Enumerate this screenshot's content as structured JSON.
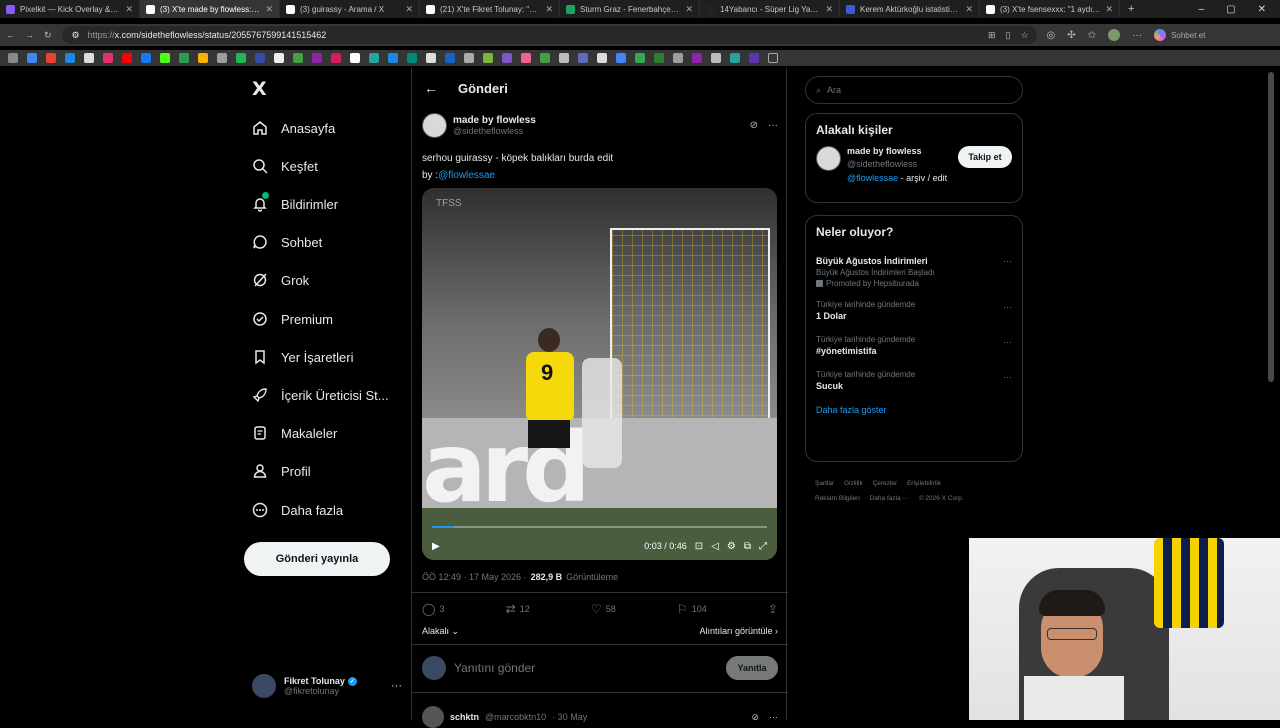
{
  "browser": {
    "tabs": [
      {
        "title": "Pixelkit — Kick Overlay & Bot",
        "color": "#8a5cf6"
      },
      {
        "title": "(3) X'te made by flowless: \"serh",
        "color": "#ffffff",
        "active": true
      },
      {
        "title": "(3) guirassy - Arama / X",
        "color": "#ffffff"
      },
      {
        "title": "(21) X'te Fikret Tolunay: \"@keys",
        "color": "#ffffff"
      },
      {
        "title": "Sturm Graz - Fenerbahçe canlı",
        "color": "#1ea362"
      },
      {
        "title": "14Yabancı - Süper Lig Yabancı",
        "color": "#222222"
      },
      {
        "title": "Kerem Aktürkoğlu istatistikleri",
        "color": "#3b5bdb"
      },
      {
        "title": "(3) X'te fsensexxx: \"1 aydır Fen",
        "color": "#ffffff"
      }
    ],
    "url_prefix": "https://",
    "url": "x.com/sidetheflowless/status/2055767599141515462",
    "chat_label": "Sohbet et",
    "window_controls": [
      "–",
      "▢",
      "✕"
    ]
  },
  "nav": {
    "logo": "X",
    "items": [
      {
        "label": "Anasayfa",
        "icon": "home-icon"
      },
      {
        "label": "Keşfet",
        "icon": "search-icon"
      },
      {
        "label": "Bildirimler",
        "icon": "bell-icon"
      },
      {
        "label": "Sohbet",
        "icon": "chat-icon"
      },
      {
        "label": "Grok",
        "icon": "grok-icon"
      },
      {
        "label": "Premium",
        "icon": "premium-icon"
      },
      {
        "label": "Yer İşaretleri",
        "icon": "bookmark-icon"
      },
      {
        "label": "İçerik Üreticisi St...",
        "icon": "rocket-icon"
      },
      {
        "label": "Makaleler",
        "icon": "article-icon"
      },
      {
        "label": "Profil",
        "icon": "person-icon"
      },
      {
        "label": "Daha fazla",
        "icon": "more-circle-icon"
      }
    ],
    "post_button": "Gönderi yayınla",
    "account": {
      "name": "Fikret Tolunay",
      "handle": "@fikretolunay"
    }
  },
  "main": {
    "header_title": "Gönderi",
    "post": {
      "author_name": "made by flowless",
      "author_handle": "@sidetheflowless",
      "text_line1": "serhou guirassy - köpek balıkları burda edit",
      "text_by": "by :",
      "text_mention": "@flowlessae",
      "video": {
        "watermark": "TFSS",
        "current_time": "0:03",
        "duration": "0:46",
        "progress": 0.065,
        "board_text": "ard"
      },
      "timestamp": "ÖÖ 12:49 · 17 May 2026 · ",
      "views_count": "282,9 B",
      "views_label": "Görüntüleme",
      "stats": {
        "replies": "3",
        "reposts": "12",
        "likes": "58",
        "bookmarks": "104"
      },
      "sort_label": "Alakalı",
      "quotes_label": "Alıntıları görüntüle"
    },
    "reply_placeholder": "Yanıtını gönder",
    "reply_button": "Yanıtla",
    "next_reply": {
      "name": "schktn",
      "handle": "@marcobktn10",
      "date": "· 30 May"
    }
  },
  "sidebar": {
    "search_placeholder": "Ara",
    "related_title": "Alakalı kişiler",
    "related": {
      "name": "made by flowless",
      "handle": "@sidetheflowless",
      "bio_mention": "@flowlessae",
      "bio_rest": " - arşiv / edit",
      "follow": "Takip et"
    },
    "trends_title": "Neler oluyor?",
    "trends": [
      {
        "context": "",
        "title": "Büyük Ağustos İndirimleri",
        "sub": "Büyük Ağustos İndirimleri Başladı",
        "promo": "Promoted by Hepsiburada"
      },
      {
        "context": "Türkiye tarihinde gündemde",
        "title": "1 Dolar"
      },
      {
        "context": "Türkiye tarihinde gündemde",
        "title": "#yönetimistifa"
      },
      {
        "context": "Türkiye tarihinde gündemde",
        "title": "Sucuk"
      }
    ],
    "show_more": "Daha fazla göster",
    "footer": [
      "Şartlar",
      "Gizlilik",
      "Çerezler",
      "Erişilebilirlik",
      "Reklam Bilgileri",
      "Daha fazla ···",
      "© 2026 X Corp."
    ]
  }
}
